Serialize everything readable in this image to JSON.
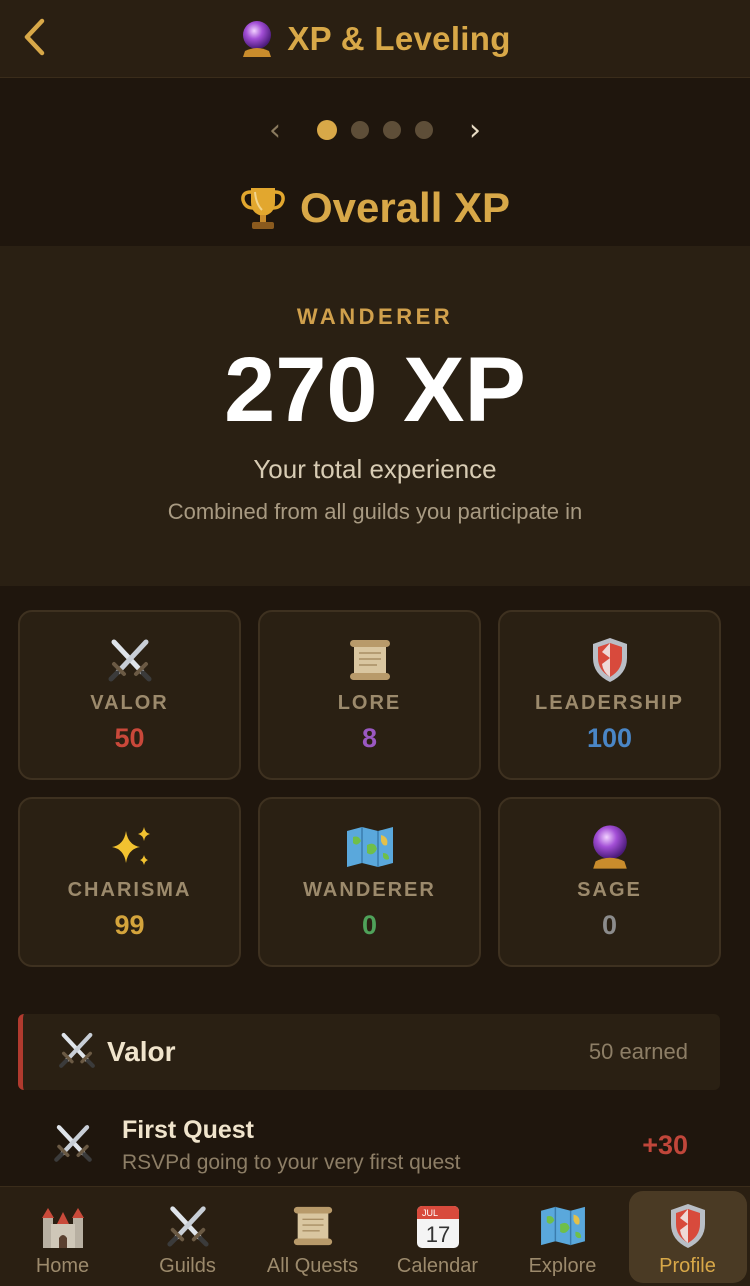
{
  "header": {
    "title": "XP & Leveling",
    "title_icon": "crystal-ball-icon"
  },
  "carousel": {
    "prev": "‹",
    "next": "›",
    "pages": 4,
    "active_page": 1
  },
  "section": {
    "title": "Overall XP",
    "icon": "trophy-icon"
  },
  "summary": {
    "rank": "WANDERER",
    "total": "270 XP",
    "subtitle": "Your total experience",
    "note": "Combined from all guilds you participate in"
  },
  "stats": [
    {
      "label": "VALOR",
      "value": "50",
      "color": "#c9483a",
      "icon": "crossed-swords-icon"
    },
    {
      "label": "LORE",
      "value": "8",
      "color": "#9a58c2",
      "icon": "scroll-icon"
    },
    {
      "label": "LEADERSHIP",
      "value": "100",
      "color": "#4a86c6",
      "icon": "shield-icon"
    },
    {
      "label": "CHARISMA",
      "value": "99",
      "color": "#d4a43c",
      "icon": "sparkles-icon"
    },
    {
      "label": "WANDERER",
      "value": "0",
      "color": "#4fa25a",
      "icon": "map-icon"
    },
    {
      "label": "SAGE",
      "value": "0",
      "color": "#8c8c8c",
      "icon": "crystal-ball-icon"
    }
  ],
  "category": {
    "name": "Valor",
    "earned": "50 earned",
    "accent": "#b03a2e"
  },
  "quests": [
    {
      "title": "First Quest",
      "description": "RSVPd going to your very first quest",
      "xp": "+30"
    }
  ],
  "tabs": [
    {
      "label": "Home",
      "icon": "castle-icon"
    },
    {
      "label": "Guilds",
      "icon": "crossed-swords-icon"
    },
    {
      "label": "All Quests",
      "icon": "scroll-icon"
    },
    {
      "label": "Calendar",
      "icon": "calendar-icon",
      "calendar_month": "JUL",
      "calendar_day": "17"
    },
    {
      "label": "Explore",
      "icon": "map-icon"
    },
    {
      "label": "Profile",
      "icon": "shield-icon",
      "active": true
    }
  ],
  "colors": {
    "accent": "#d8a848",
    "background": "#1f160d",
    "card": "#2a2013"
  }
}
